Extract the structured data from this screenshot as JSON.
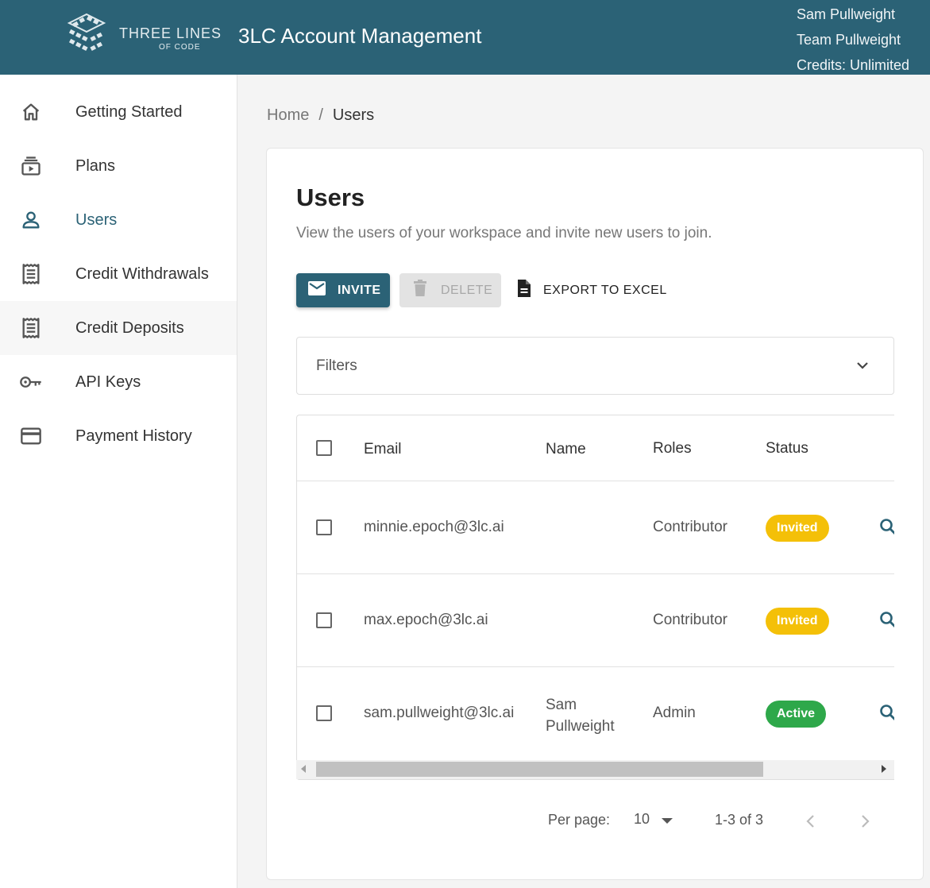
{
  "brand": {
    "logo_line1": "THREE LINES",
    "logo_line2": "OF CODE",
    "app_title": "3LC Account Management"
  },
  "user": {
    "name": "Sam Pullweight",
    "team": "Team Pullweight",
    "credits": "Credits: Unlimited"
  },
  "sidebar": {
    "items": [
      {
        "label": "Getting Started",
        "icon": "home-icon"
      },
      {
        "label": "Plans",
        "icon": "plans-icon"
      },
      {
        "label": "Users",
        "icon": "user-icon",
        "active": true
      },
      {
        "label": "Credit Withdrawals",
        "icon": "receipt-icon"
      },
      {
        "label": "Credit Deposits",
        "icon": "receipt-icon"
      },
      {
        "label": "API Keys",
        "icon": "key-icon"
      },
      {
        "label": "Payment History",
        "icon": "credit-card-icon"
      }
    ]
  },
  "breadcrumb": {
    "home": "Home",
    "separator": "/",
    "current": "Users"
  },
  "page": {
    "title": "Users",
    "subtitle": "View the users of your workspace and invite new users to join."
  },
  "toolbar": {
    "invite_label": "INVITE",
    "delete_label": "DELETE",
    "export_label": "EXPORT TO EXCEL"
  },
  "filters": {
    "label": "Filters"
  },
  "table": {
    "columns": [
      "Email",
      "Name",
      "Roles",
      "Status"
    ],
    "rows": [
      {
        "email": "minnie.epoch@3lc.ai",
        "name": "",
        "role": "Contributor",
        "status": "Invited"
      },
      {
        "email": "max.epoch@3lc.ai",
        "name": "",
        "role": "Contributor",
        "status": "Invited"
      },
      {
        "email": "sam.pullweight@3lc.ai",
        "name_line1": "Sam",
        "name_line2": "Pullweight",
        "role": "Admin",
        "status": "Active"
      }
    ]
  },
  "pagination": {
    "per_page_label": "Per page:",
    "per_page_value": "10",
    "range": "1-3 of 3"
  },
  "colors": {
    "primary": "#2b6276",
    "invited": "#f4c008",
    "active": "#2ea84a"
  }
}
